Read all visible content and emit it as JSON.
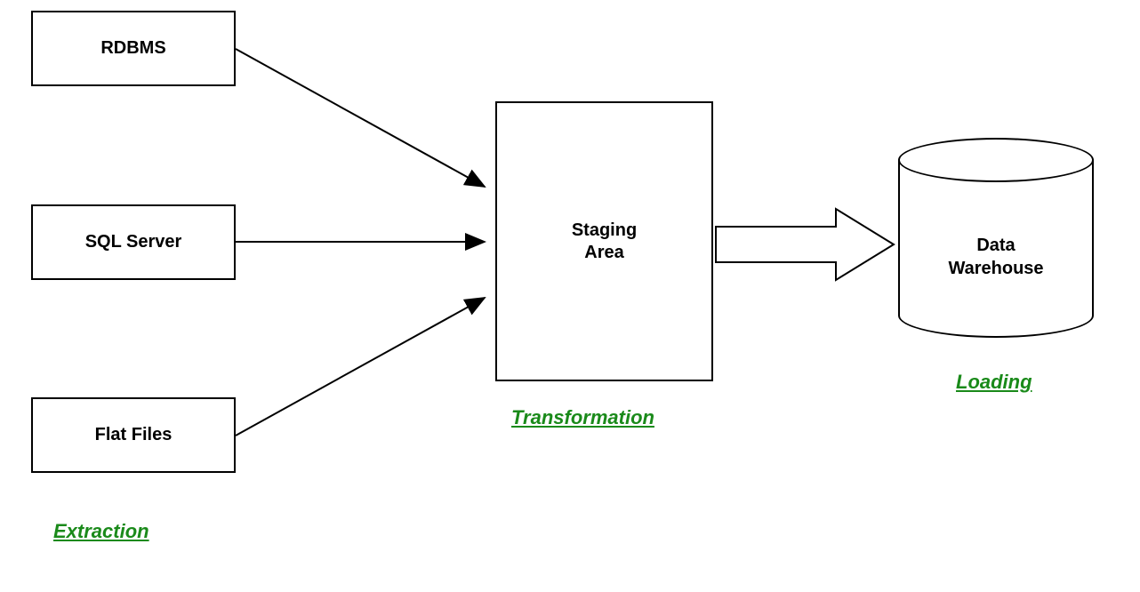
{
  "sources": {
    "rdbms": "RDBMS",
    "sqlserver": "SQL Server",
    "flatfiles": "Flat Files"
  },
  "staging": {
    "label_line1": "Staging",
    "label_line2": "Area"
  },
  "warehouse": {
    "label_line1": "Data",
    "label_line2": "Warehouse"
  },
  "phases": {
    "extraction": "Extraction",
    "transformation": "Transformation",
    "loading": "Loading"
  },
  "colors": {
    "phase_label": "#1a8a1a",
    "stroke": "#000000"
  }
}
